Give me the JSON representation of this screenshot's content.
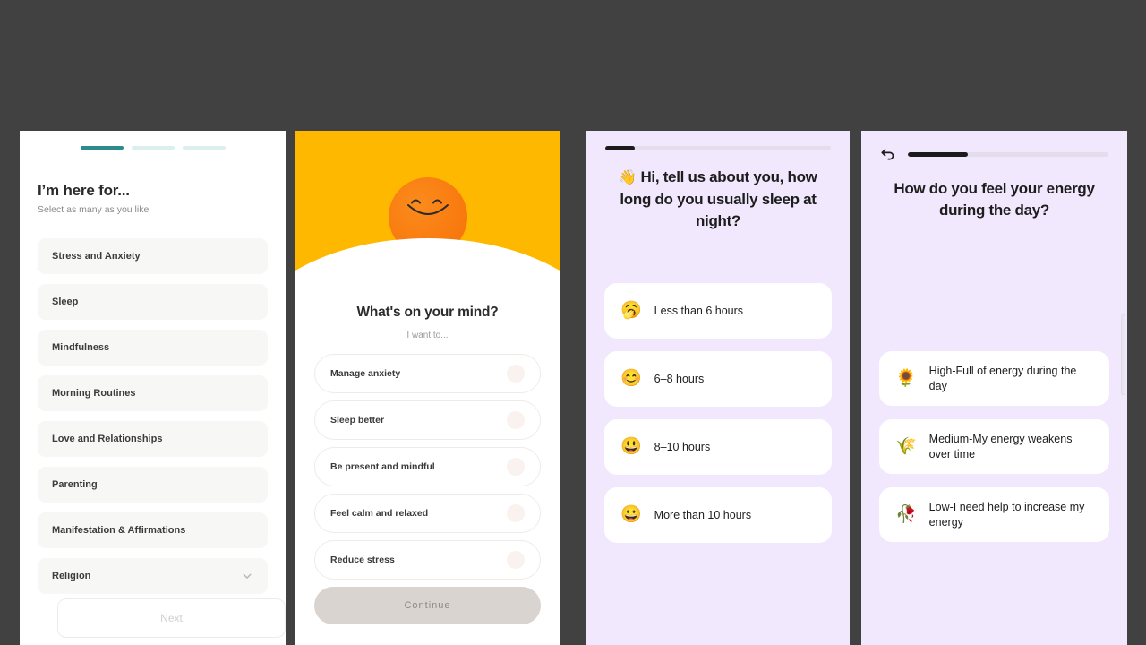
{
  "theme": {
    "desktop_bg": "#414141",
    "teal": "#2e8b8b",
    "teal_pale": "#dcefef",
    "orange": "#ffb800",
    "sun": "#f97b10",
    "lavender": "#f1e8fd",
    "card_white": "#ffffff"
  },
  "panel1": {
    "progress": {
      "total": 3,
      "active_index": 0
    },
    "title": "I’m here for...",
    "subtitle": "Select as many as you like",
    "options": [
      {
        "label": "Stress and Anxiety",
        "has_chevron": false
      },
      {
        "label": "Sleep",
        "has_chevron": false
      },
      {
        "label": "Mindfulness",
        "has_chevron": false
      },
      {
        "label": "Morning Routines",
        "has_chevron": false
      },
      {
        "label": "Love and Relationships",
        "has_chevron": false
      },
      {
        "label": "Parenting",
        "has_chevron": false
      },
      {
        "label": "Manifestation & Affirmations",
        "has_chevron": false
      },
      {
        "label": "Religion",
        "has_chevron": true
      }
    ],
    "next_label": "Next",
    "chevron_icon": "chevron-down-icon"
  },
  "panel2": {
    "hero_icon": "smiling-sun-icon",
    "title": "What's on your mind?",
    "subtitle": "I want to...",
    "options": [
      {
        "label": "Manage anxiety"
      },
      {
        "label": "Sleep better"
      },
      {
        "label": "Be present and mindful"
      },
      {
        "label": "Feel calm and relaxed"
      },
      {
        "label": "Reduce stress"
      }
    ],
    "continue_label": "Continue"
  },
  "panel3": {
    "progress_percent": 13,
    "title_emoji": "👋",
    "title": "Hi, tell us about you, how long do you usually sleep at night?",
    "options": [
      {
        "emoji": "🥱",
        "label": "Less than 6 hours"
      },
      {
        "emoji": "😊",
        "label": "6–8 hours"
      },
      {
        "emoji": "😃",
        "label": "8–10 hours"
      },
      {
        "emoji": "😀",
        "label": "More than 10 hours"
      }
    ]
  },
  "panel4": {
    "back_icon": "back-arrow-icon",
    "progress_percent": 30,
    "title": "How do you feel your energy during the day?",
    "options": [
      {
        "emoji": "🌻",
        "label": "High-Full of energy during the day"
      },
      {
        "emoji": "🌾",
        "label": "Medium-My energy weakens over time"
      },
      {
        "emoji": "🥀",
        "label": "Low-I need help to increase my energy"
      }
    ]
  }
}
